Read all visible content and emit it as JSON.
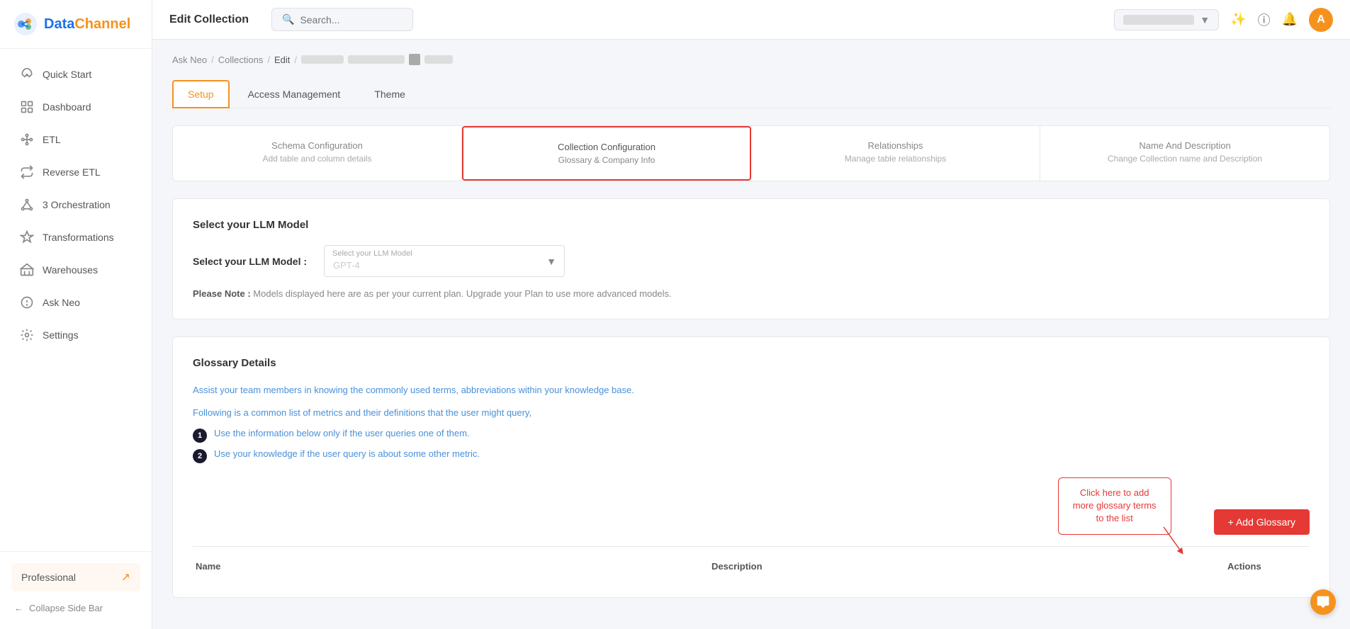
{
  "app": {
    "name": "DataChannel",
    "logo_data": "Data",
    "logo_channel": "Channel"
  },
  "header": {
    "title": "Edit Collection",
    "search_placeholder": "Search...",
    "user_avatar": "A"
  },
  "breadcrumb": {
    "items": [
      "Ask Neo",
      "Collections",
      "Edit"
    ],
    "separators": [
      "/",
      "/",
      "/"
    ]
  },
  "tabs": {
    "items": [
      "Setup",
      "Access Management",
      "Theme"
    ],
    "active": "Setup"
  },
  "step_tabs": [
    {
      "title": "Schema Configuration",
      "subtitle": "Add table and column details",
      "active": false
    },
    {
      "title": "Collection Configuration",
      "subtitle": "Glossary & Company Info",
      "active": true
    },
    {
      "title": "Relationships",
      "subtitle": "Manage table relationships",
      "active": false
    },
    {
      "title": "Name And Description",
      "subtitle": "Change Collection name and Description",
      "active": false
    }
  ],
  "llm_section": {
    "title": "Select your LLM Model",
    "field_label": "Select your LLM Model :",
    "select_label": "Select your LLM Model",
    "select_value": "GPT-4",
    "note_prefix": "Please Note :",
    "note_text": "Models displayed here are as per your current plan. Upgrade your Plan to use more advanced models."
  },
  "glossary_section": {
    "title": "Glossary Details",
    "desc_line1": "Assist your team members in knowing the commonly used terms, abbreviations within your knowledge base.",
    "desc_line2": "Following is a common list of metrics and their definitions that the user might query,",
    "instructions": [
      "Use the information below only if the user queries one of them.",
      "Use your knowledge if the user query is about some other metric."
    ],
    "callout_text": "Click here to add more glossary terms to the list",
    "add_button": "+ Add Glossary"
  },
  "table": {
    "headers": [
      "Name",
      "Description",
      "Actions"
    ]
  },
  "sidebar": {
    "nav_items": [
      {
        "label": "Quick Start",
        "icon": "rocket"
      },
      {
        "label": "Dashboard",
        "icon": "dashboard"
      },
      {
        "label": "ETL",
        "icon": "etl"
      },
      {
        "label": "Reverse ETL",
        "icon": "reverse-etl"
      },
      {
        "label": "Orchestration",
        "icon": "orchestration"
      },
      {
        "label": "Transformations",
        "icon": "transformations"
      },
      {
        "label": "Warehouses",
        "icon": "warehouses"
      },
      {
        "label": "Ask Neo",
        "icon": "ask-neo"
      },
      {
        "label": "Settings",
        "icon": "settings"
      }
    ],
    "plan_label": "Professional",
    "collapse_label": "Collapse Side Bar"
  }
}
